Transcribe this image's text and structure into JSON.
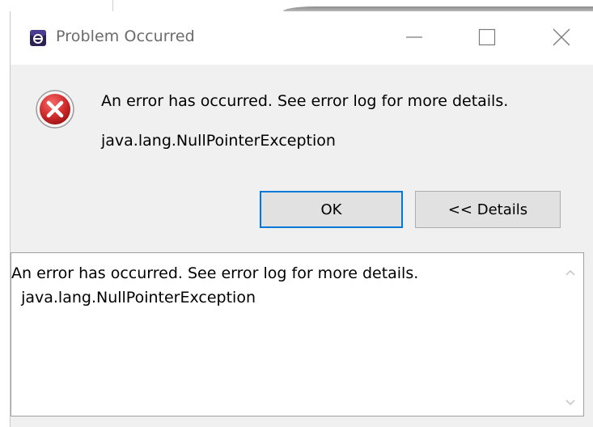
{
  "window": {
    "title": "Problem Occurred",
    "app_icon": "eclipse-app-icon",
    "controls": [
      "minimize-icon",
      "maximize-icon",
      "close-icon"
    ]
  },
  "message": {
    "icon": "error-icon",
    "main": "An error has occurred. See error log for more details.",
    "sub": "java.lang.NullPointerException"
  },
  "buttons": {
    "ok_label": "OK",
    "details_label": "<< Details"
  },
  "details": {
    "text": "An error has occurred. See error log for more details.\n  java.lang.NullPointerException"
  },
  "colors": {
    "dialog_bg": "#f0f0f0",
    "focus_border": "#0078d7",
    "error_red": "#d32f2f"
  }
}
